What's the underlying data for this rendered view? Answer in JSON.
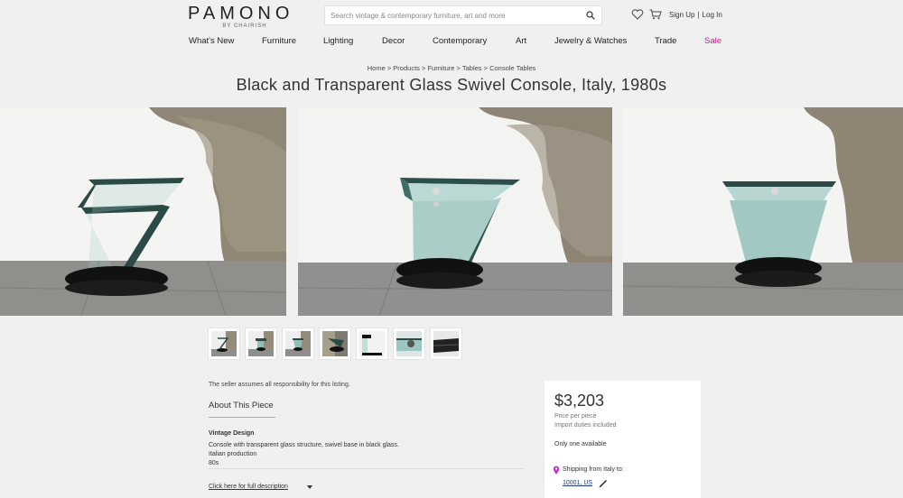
{
  "brand": {
    "name": "PAMONO",
    "sub": "BY CHAIRISH"
  },
  "search": {
    "placeholder": "Search vintage & contemporary furniture, art and more"
  },
  "auth": {
    "sign_up": "Sign Up",
    "separator": "|",
    "log_in": "Log In"
  },
  "nav": [
    {
      "label": "What's New"
    },
    {
      "label": "Furniture"
    },
    {
      "label": "Lighting"
    },
    {
      "label": "Decor"
    },
    {
      "label": "Contemporary"
    },
    {
      "label": "Art"
    },
    {
      "label": "Jewelry & Watches"
    },
    {
      "label": "Trade"
    },
    {
      "label": "Sale"
    }
  ],
  "breadcrumb": "Home > Products > Furniture > Tables > Console Tables",
  "product": {
    "title": "Black and Transparent Glass Swivel Console, Italy, 1980s",
    "seller_note": "The seller assumes all responsibility for this listing.",
    "about_heading": "About This Piece",
    "design_heading": "Vintage Design",
    "design_lines": [
      "Console with transparent glass structure, swivel base in black glass.",
      "Italian production",
      "80s"
    ],
    "full_description_link": "Click here for full description"
  },
  "pricing": {
    "price": "$3,203",
    "price_per": "Price per piece",
    "duties": "Import duties included",
    "availability": "Only one available",
    "shipping_label": "Shipping from Italy to:",
    "shipping_destination": "10001, US"
  },
  "icons": {
    "search": "search-icon",
    "favorites": "heart-icon",
    "cart": "cart-icon",
    "location": "location-pin-icon",
    "edit": "pencil-icon"
  },
  "colors": {
    "sale": "#c9198f",
    "location_pin": "#c62ad0",
    "link": "#1f3a8a",
    "glass": "#4f8f8a"
  }
}
